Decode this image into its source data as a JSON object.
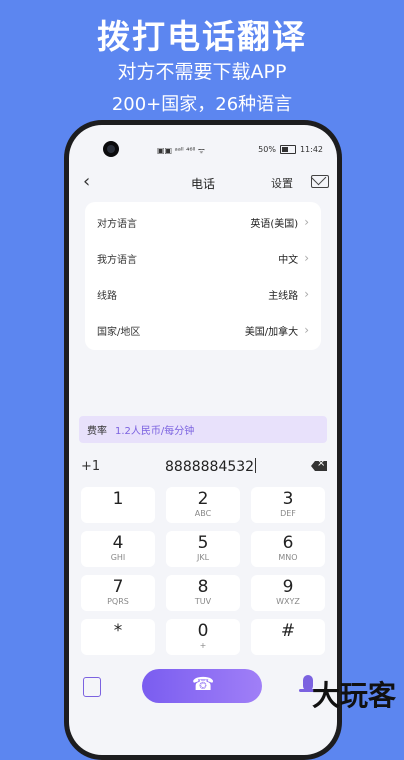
{
  "promo": {
    "headline": "拨打电话翻译",
    "line1": "对方不需要下载APP",
    "line2": "200+国家，26种语言"
  },
  "status_bar": {
    "left": "▣▣ ᵃᵃˡˡ ⁴⁶ˡˡ ᯤ",
    "battery": "50%",
    "time": "11:42"
  },
  "nav": {
    "back": "‹",
    "title": "电话",
    "settings": "设置"
  },
  "settings_card": {
    "rows": [
      {
        "label": "对方语言",
        "value": "英语(美国)"
      },
      {
        "label": "我方语言",
        "value": "中文"
      },
      {
        "label": "线路",
        "value": "主线路"
      },
      {
        "label": "国家/地区",
        "value": "美国/加拿大"
      }
    ]
  },
  "rate": {
    "label": "费率",
    "value": "1.2人民币/每分钟"
  },
  "dial": {
    "country_code": "+1",
    "number": "8888884532"
  },
  "keypad": [
    {
      "digit": "1",
      "letters": ""
    },
    {
      "digit": "2",
      "letters": "ABC"
    },
    {
      "digit": "3",
      "letters": "DEF"
    },
    {
      "digit": "4",
      "letters": "GHI"
    },
    {
      "digit": "5",
      "letters": "JKL"
    },
    {
      "digit": "6",
      "letters": "MNO"
    },
    {
      "digit": "7",
      "letters": "PQRS"
    },
    {
      "digit": "8",
      "letters": "TUV"
    },
    {
      "digit": "9",
      "letters": "WXYZ"
    },
    {
      "digit": "*",
      "letters": ""
    },
    {
      "digit": "0",
      "letters": "+"
    },
    {
      "digit": "#",
      "letters": ""
    }
  ],
  "watermark": "大玩客",
  "colors": {
    "background": "#5c86f0",
    "accent": "#7b62e0",
    "rate_bg": "#e8e1fb"
  }
}
